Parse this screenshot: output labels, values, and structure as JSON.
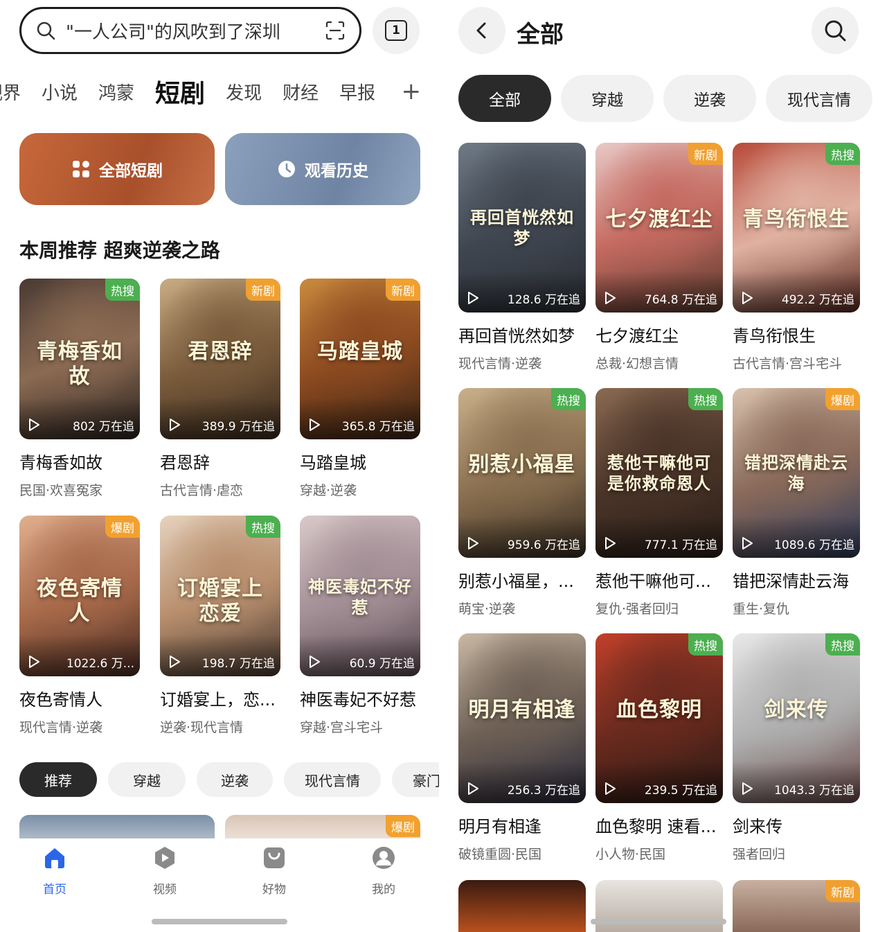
{
  "left": {
    "search": {
      "query": "\"一人公司\"的风吹到了深圳",
      "tab_count": "1"
    },
    "categories": [
      "视界",
      "小说",
      "鸿蒙",
      "短剧",
      "发现",
      "财经",
      "早报"
    ],
    "active_category": "短剧",
    "plus": "+",
    "banners": {
      "all": "全部短剧",
      "history": "观看历史"
    },
    "section_title": "本周推荐 超爽逆袭之路",
    "cards": [
      {
        "poster_title": "青梅香如故",
        "name": "青梅香如故",
        "tags": "民国·欢喜冤家",
        "count": "802 万在追",
        "badge": "热搜",
        "badge_type": "hot",
        "colors": [
          "#4a3a33",
          "#8a6a52",
          "#2b2320"
        ]
      },
      {
        "poster_title": "君恩辞",
        "name": "君恩辞",
        "tags": "古代言情·虐恋",
        "count": "389.9 万在追",
        "badge": "新剧",
        "badge_type": "new",
        "colors": [
          "#c9ad84",
          "#7a5c3c",
          "#3b2b1e"
        ]
      },
      {
        "poster_title": "马踏皇城",
        "name": "马踏皇城",
        "tags": "穿越·逆袭",
        "count": "365.8 万在追",
        "badge": "新剧",
        "badge_type": "new",
        "colors": [
          "#c98a3e",
          "#8c4a20",
          "#3a2414"
        ]
      },
      {
        "poster_title": "夜色寄情人",
        "name": "夜色寄情人",
        "tags": "现代言情·逆袭",
        "count": "1022.6 万...",
        "badge": "爆剧",
        "badge_type": "boom",
        "colors": [
          "#e0b090",
          "#a86a4a",
          "#4a2c22"
        ]
      },
      {
        "poster_title": "订婚宴上恋爱",
        "name": "订婚宴上，恋...",
        "tags": "逆袭·现代言情",
        "count": "198.7 万在追",
        "badge": "热搜",
        "badge_type": "hot",
        "colors": [
          "#e6d2bd",
          "#b88f6e",
          "#4a3a30"
        ]
      },
      {
        "poster_title": "神医毒妃不好惹",
        "name": "神医毒妃不好惹",
        "tags": "穿越·宫斗宅斗",
        "count": "60.9 万在追",
        "badge": "",
        "badge_type": "",
        "colors": [
          "#d9c9c9",
          "#a28e95",
          "#5a4a52"
        ]
      }
    ],
    "chips": [
      "推荐",
      "穿越",
      "逆袭",
      "现代言情",
      "豪门"
    ],
    "peek_badge": "爆剧",
    "nav": [
      {
        "label": "首页",
        "icon": "home-icon"
      },
      {
        "label": "视频",
        "icon": "video-icon"
      },
      {
        "label": "好物",
        "icon": "shop-icon"
      },
      {
        "label": "我的",
        "icon": "profile-icon"
      }
    ]
  },
  "right": {
    "title": "全部",
    "chips": [
      "全部",
      "穿越",
      "逆袭",
      "现代言情"
    ],
    "cards": [
      {
        "poster_title": "再回首恍然如梦",
        "name": "再回首恍然如梦",
        "tags": "现代言情·逆袭",
        "count": "128.6 万在追",
        "badge": "",
        "badge_type": "",
        "colors": [
          "#6f7a86",
          "#3f4650",
          "#2a2e34"
        ]
      },
      {
        "poster_title": "七夕渡红尘",
        "name": "七夕渡红尘",
        "tags": "总裁·幻想言情",
        "count": "764.8 万在追",
        "badge": "新剧",
        "badge_type": "new",
        "colors": [
          "#e8c9c6",
          "#c46a60",
          "#5a3a2e"
        ]
      },
      {
        "poster_title": "青鸟衔恨生",
        "name": "青鸟衔恨生",
        "tags": "古代言情·宫斗宅斗",
        "count": "492.2 万在追",
        "badge": "热搜",
        "badge_type": "hot",
        "colors": [
          "#b84a3a",
          "#e0b0a0",
          "#5a2a20"
        ]
      },
      {
        "poster_title": "别惹小福星",
        "name": "别惹小福星，...",
        "tags": "萌宝·逆袭",
        "count": "959.6 万在追",
        "badge": "热搜",
        "badge_type": "hot",
        "colors": [
          "#c9b08a",
          "#8a7050",
          "#3a2e22"
        ]
      },
      {
        "poster_title": "惹他干嘛他可是你救命恩人",
        "name": "惹他干嘛他可...",
        "tags": "复仇·强者回归",
        "count": "777.1 万在追",
        "badge": "热搜",
        "badge_type": "hot",
        "colors": [
          "#8a6a52",
          "#4a3428",
          "#2a1e18"
        ]
      },
      {
        "poster_title": "错把深情赴云海",
        "name": "错把深情赴云海",
        "tags": "重生·复仇",
        "count": "1089.6 万在追",
        "badge": "爆剧",
        "badge_type": "boom",
        "colors": [
          "#d9c2ae",
          "#8a6a5a",
          "#2e3a5a"
        ]
      },
      {
        "poster_title": "明月有相逢",
        "name": "明月有相逢",
        "tags": "破镜重圆·民国",
        "count": "256.3 万在追",
        "badge": "",
        "badge_type": "",
        "colors": [
          "#c9b8a4",
          "#6e6055",
          "#2a2a3a"
        ]
      },
      {
        "poster_title": "血色黎明",
        "name": "血色黎明 速看...",
        "tags": "小人物·民国",
        "count": "239.5 万在追",
        "badge": "热搜",
        "badge_type": "hot",
        "colors": [
          "#c0402a",
          "#6a2a1e",
          "#2a1a14"
        ]
      },
      {
        "poster_title": "剑来传",
        "name": "剑来传",
        "tags": "强者回归",
        "count": "1043.3 万在追",
        "badge": "热搜",
        "badge_type": "hot",
        "colors": [
          "#e8e8e8",
          "#b0b0b0",
          "#6a4a4a"
        ]
      }
    ],
    "peek_badge": "新剧"
  }
}
